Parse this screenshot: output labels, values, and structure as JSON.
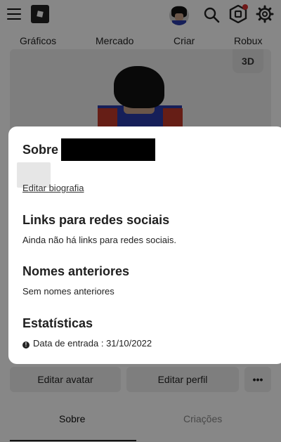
{
  "nav": {
    "items": [
      "Gráficos",
      "Mercado",
      "Criar",
      "Robux"
    ]
  },
  "avatar_stage": {
    "toggle_label": "3D"
  },
  "actions": {
    "edit_avatar": "Editar avatar",
    "edit_profile": "Editar perfil",
    "more": "•••"
  },
  "tabs": {
    "about": "Sobre",
    "creations": "Criações"
  },
  "modal": {
    "title": "Sobre",
    "edit_bio": "Editar biografia",
    "social_links_heading": "Links para redes sociais",
    "social_links_text": "Ainda não há links para redes sociais.",
    "previous_names_heading": "Nomes anteriores",
    "previous_names_text": "Sem nomes anteriores",
    "stats_heading": "Estatísticas",
    "join_date_label": "Data de entrada : 31/10/2022"
  },
  "colors": {
    "overlay": "#000000",
    "modal_bg": "#ffffff",
    "notification_dot": "#d32f2f"
  },
  "icons": {
    "menu": "hamburger-icon",
    "logo": "roblox-logo-icon",
    "search": "search-icon",
    "robux": "robux-icon",
    "settings": "gear-icon",
    "info": "info-icon",
    "sparkle": "sparkle-icon"
  }
}
